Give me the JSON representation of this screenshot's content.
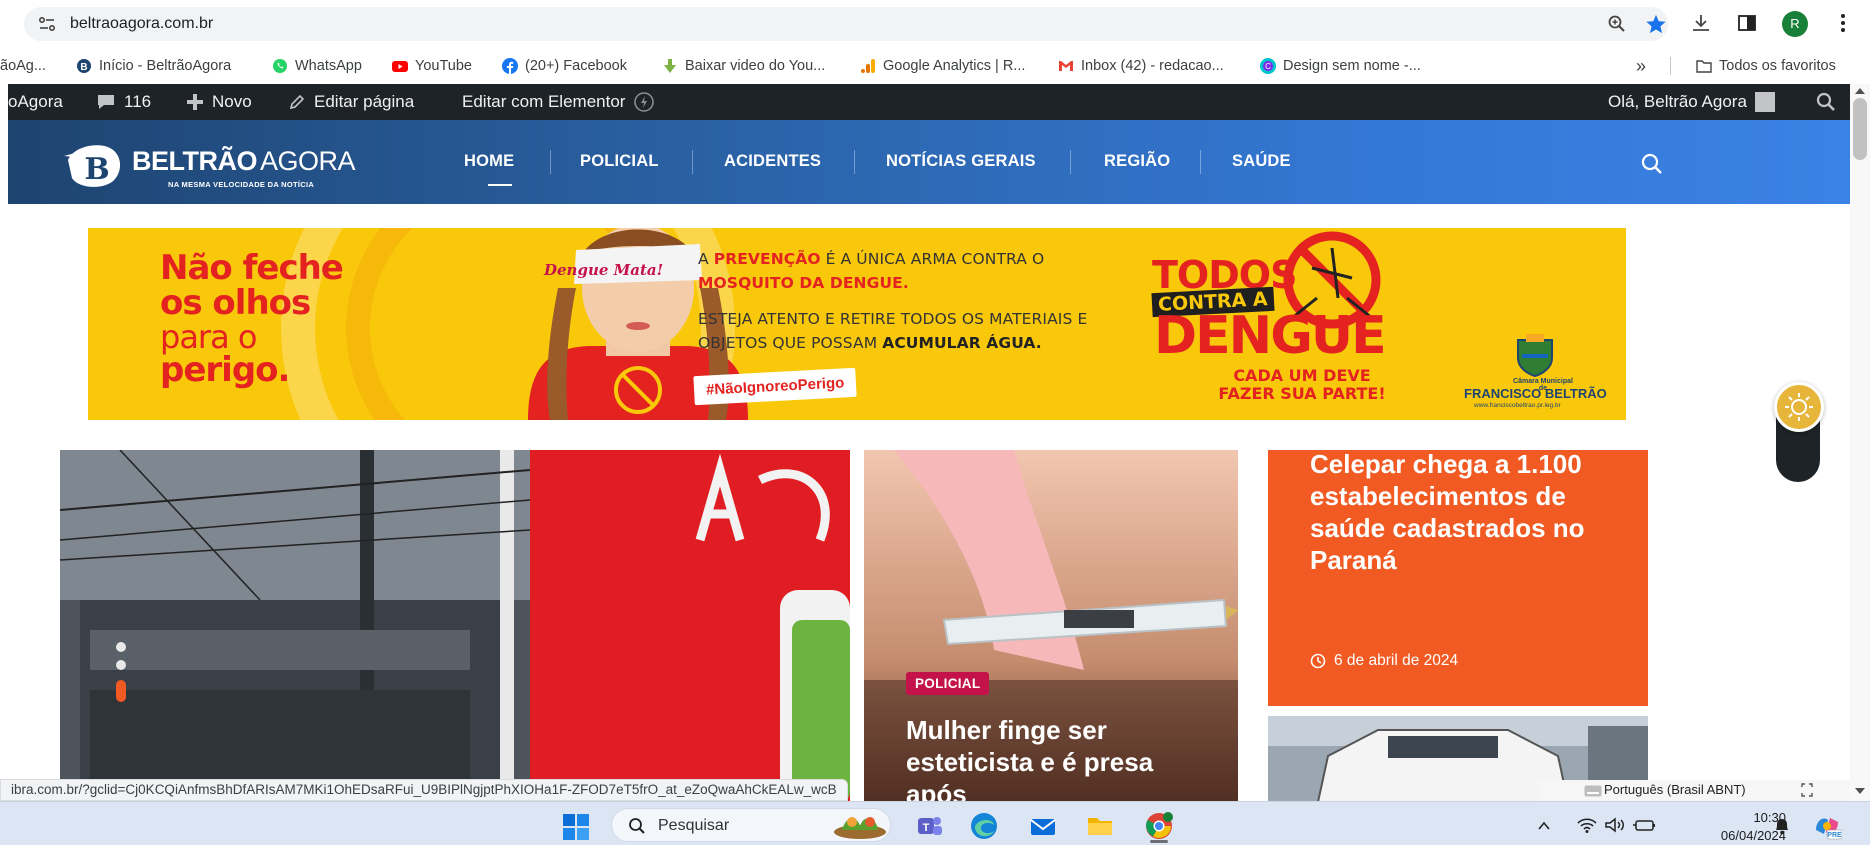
{
  "browser": {
    "url": "beltraoagora.com.br",
    "profile_initial": "R",
    "bookmarks": [
      "ãoAg...",
      "Início - BeltrãoAgora",
      "WhatsApp",
      "YouTube",
      "(20+) Facebook",
      "Baixar video do You...",
      "Google Analytics | R...",
      "Inbox (42) - redacao...",
      "Design sem nome -..."
    ],
    "bookmarks_overflow": "»",
    "all_bookmarks": "Todos os favoritos",
    "status_url": "ibra.com.br/?gclid=Cj0KCQiAnfmsBhDfARIsAM7MKi1OhEDsaRFui_U9BIPlNgjptPhXIOHa1F-ZFOD7eT5frO_at_eZoQwaAhCkEALw_wcB"
  },
  "wpbar": {
    "site": "oAgora",
    "comments_count": "116",
    "new_label": "Novo",
    "edit_page": "Editar página",
    "edit_elementor": "Editar com Elementor",
    "greeting": "Olá, Beltrão Agora"
  },
  "site": {
    "logo_bold": "BELTRÃO",
    "logo_light": "AGORA",
    "tagline": "NA MESMA VELOCIDADE DA NOTÍCIA",
    "nav": [
      "HOME",
      "POLICIAL",
      "ACIDENTES",
      "NOTÍCIAS GERAIS",
      "REGIÃO",
      "SAÚDE"
    ]
  },
  "banner": {
    "headline_lines": [
      "Não feche",
      "os olhos",
      "para o",
      "perigo."
    ],
    "blindfold": "Dengue Mata!",
    "copy_line1_pre": "A ",
    "copy_line1_bold": "PREVENÇÃO",
    "copy_line1_post": " É A ÚNICA ARMA CONTRA O",
    "copy_line2": "MOSQUITO DA DENGUE.",
    "copy_line3": "ESTEJA ATENTO E RETIRE TODOS OS MATERIAIS E",
    "copy_line4_pre": "OBJETOS QUE POSSAM ",
    "copy_line4_bold": "ACUMULAR ÁGUA.",
    "hashtag": "#NãoIgnoreoPerigo",
    "todos": "TODOS",
    "contra": "CONTRA A",
    "dengue": "DENGUE",
    "cada_line1": "CADA UM DEVE",
    "cada_line2": "FAZER SUA PARTE!",
    "camara_small": "Câmara Municipal de",
    "camara_name": "FRANCISCO BELTRÃO",
    "camara_url": "www.franciscobeltrao.pr.leg.br"
  },
  "cards": {
    "mid": {
      "category": "POLICIAL",
      "title": "Mulher finge ser esteticista e é presa após"
    },
    "orange": {
      "title": "Celepar chega a 1.100 estabelecimentos de saúde cadastrados no Paraná",
      "date": "6 de abril de 2024"
    }
  },
  "language_widget": "Português (Brasil ABNT)",
  "taskbar": {
    "search_placeholder": "Pesquisar",
    "time": "10:30",
    "date": "06/04/2024"
  },
  "colors": {
    "brand_orange": "#f15a22",
    "policial_badge": "#c4124b",
    "banner_yellow": "#f9c80b",
    "banner_red": "#e42220",
    "header_blue": "#2b63a8",
    "wpbar": "#1d2327"
  }
}
